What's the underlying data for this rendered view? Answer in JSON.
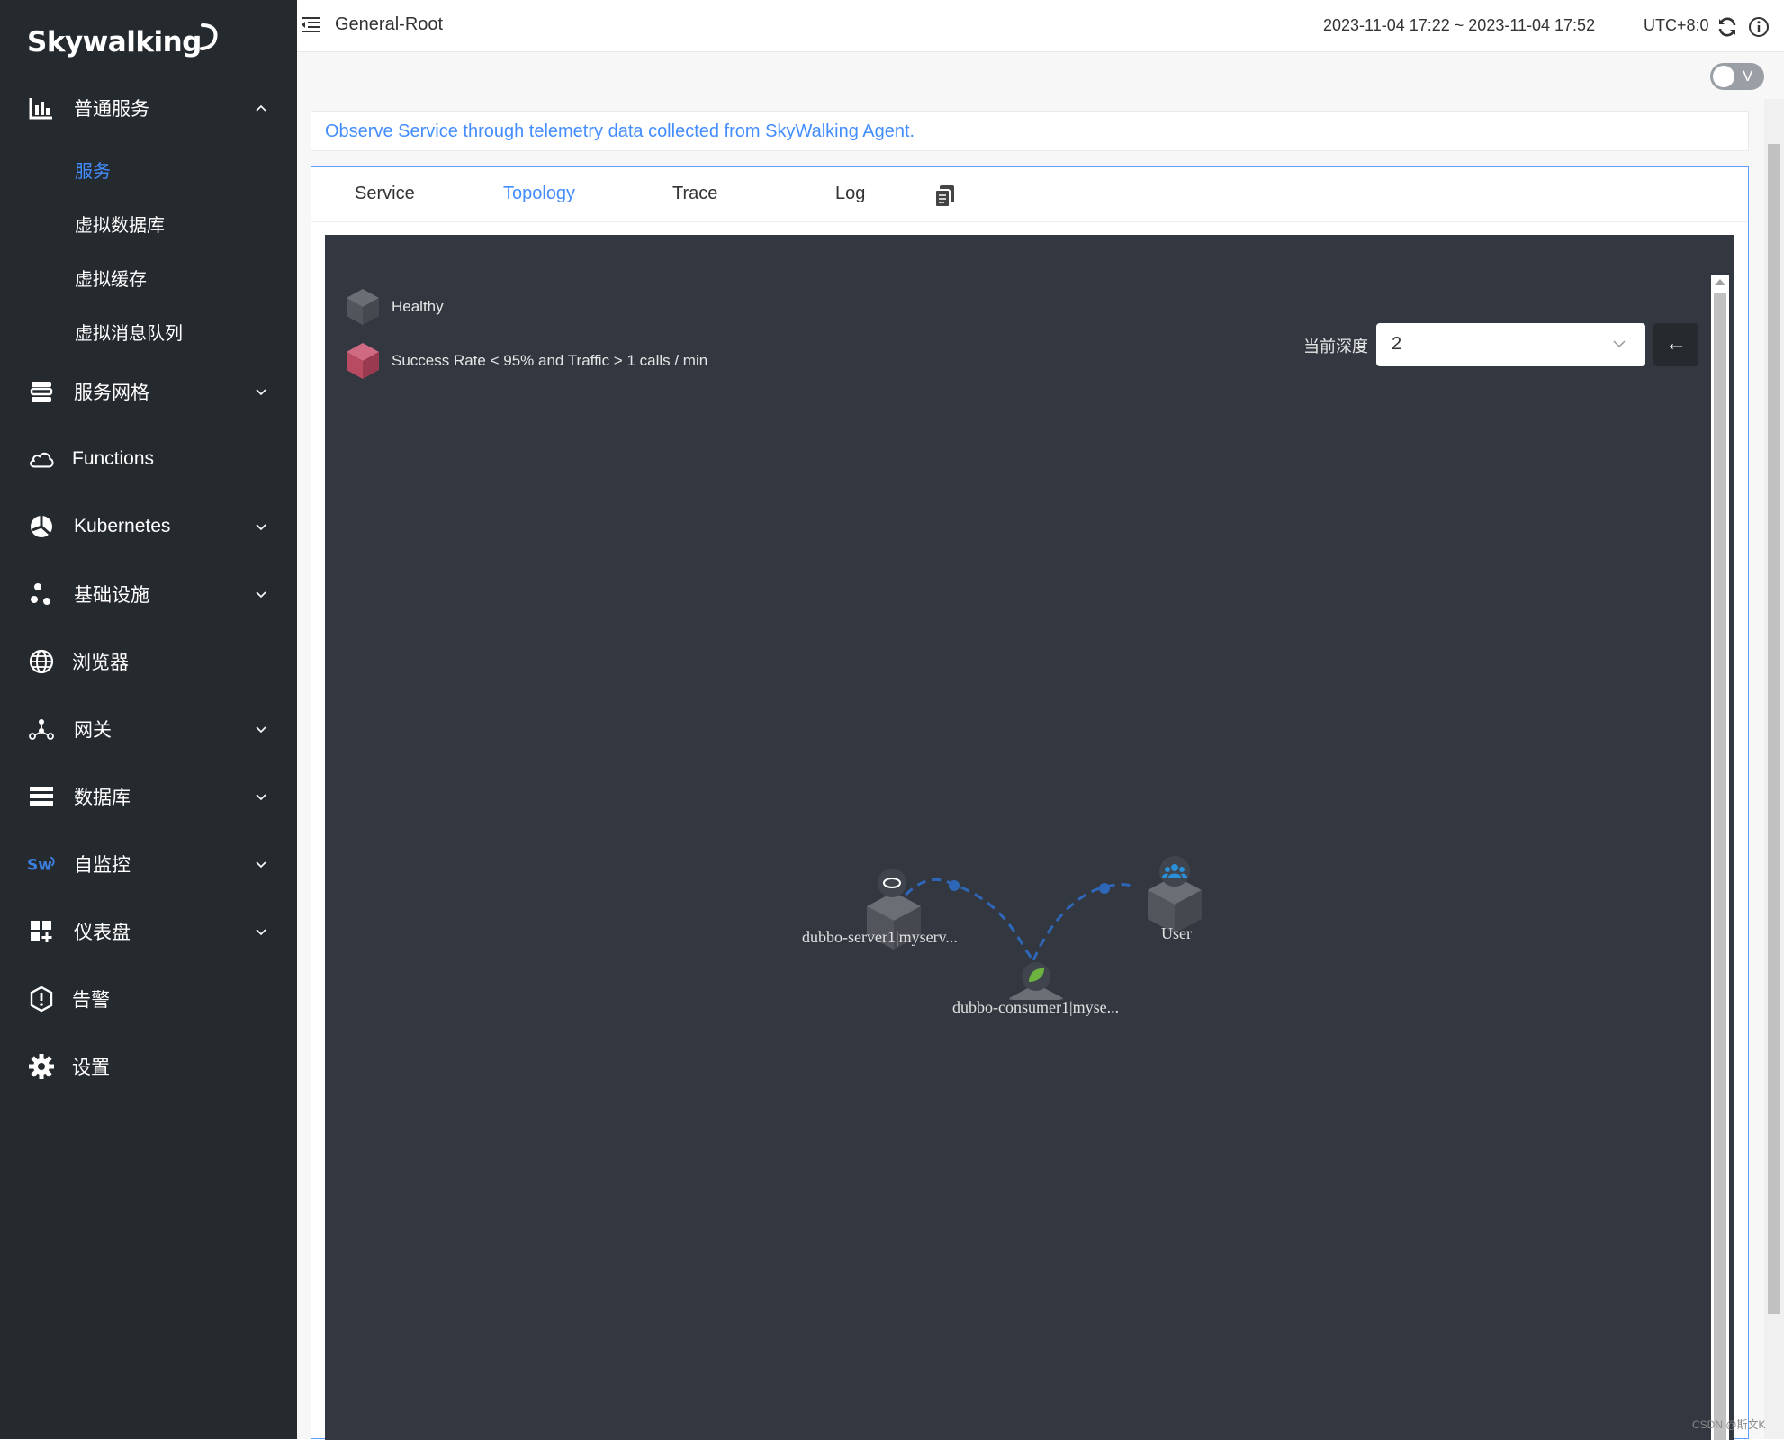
{
  "app": {
    "logo_text": "Skywalking"
  },
  "sidebar": {
    "items": [
      {
        "label": "普通服务",
        "icon": "bar-chart-icon",
        "expanded": true,
        "children": [
          "服务",
          "虚拟数据库",
          "虚拟缓存",
          "虚拟消息队列"
        ],
        "active_child": "服务"
      },
      {
        "label": "服务网格",
        "icon": "layers-icon"
      },
      {
        "label": "Functions",
        "icon": "cloud-icon"
      },
      {
        "label": "Kubernetes",
        "icon": "kubernetes-icon"
      },
      {
        "label": "基础设施",
        "icon": "infrastructure-icon"
      },
      {
        "label": "浏览器",
        "icon": "globe-icon"
      },
      {
        "label": "网关",
        "icon": "gateway-icon"
      },
      {
        "label": "数据库",
        "icon": "database-icon"
      },
      {
        "label": "自监控",
        "icon": "sw-logo-icon"
      },
      {
        "label": "仪表盘",
        "icon": "dashboard-icon"
      },
      {
        "label": "告警",
        "icon": "alert-icon"
      },
      {
        "label": "设置",
        "icon": "gear-icon"
      }
    ]
  },
  "header": {
    "title": "General-Root",
    "time_range": "2023-11-04 17:22 ~ 2023-11-04 17:52",
    "timezone": "UTC+8:0"
  },
  "toggle": {
    "label": "V",
    "on": false
  },
  "description": "Observe Service through telemetry data collected from SkyWalking Agent.",
  "tabs": {
    "items": [
      "Service",
      "Topology",
      "Trace",
      "Log"
    ],
    "active": "Topology"
  },
  "topology": {
    "legend": {
      "healthy": "Healthy",
      "unhealthy": "Success Rate < 95% and Traffic > 1 calls / min"
    },
    "depth_label": "当前深度",
    "depth_value": "2",
    "back_icon": "arrow-left-icon",
    "nodes": [
      {
        "name": "dubbo-server1|myserv...",
        "type": "dubbo"
      },
      {
        "name": "dubbo-consumer1|myse...",
        "type": "spring"
      },
      {
        "name": "User",
        "type": "user"
      }
    ],
    "edges": [
      {
        "from": "dubbo-consumer1|myse...",
        "to": "dubbo-server1|myserv..."
      },
      {
        "from": "User",
        "to": "dubbo-consumer1|myse..."
      }
    ]
  },
  "colors": {
    "accent": "#448dfe",
    "sidebar_bg": "#252a2f",
    "topology_bg": "#333840",
    "edge": "#2f67b8",
    "unhealthy": "#b84a62"
  },
  "watermark": "CSDN @斯文K"
}
